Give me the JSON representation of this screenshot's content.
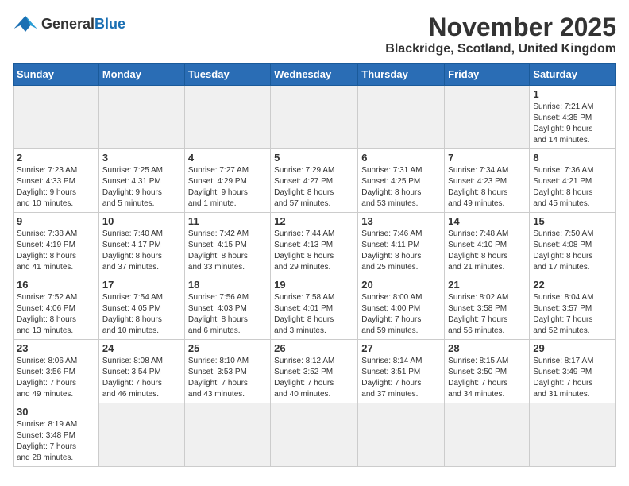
{
  "header": {
    "logo_text_general": "General",
    "logo_text_blue": "Blue",
    "title": "November 2025",
    "subtitle": "Blackridge, Scotland, United Kingdom"
  },
  "days_of_week": [
    "Sunday",
    "Monday",
    "Tuesday",
    "Wednesday",
    "Thursday",
    "Friday",
    "Saturday"
  ],
  "weeks": [
    [
      {
        "day": "",
        "info": ""
      },
      {
        "day": "",
        "info": ""
      },
      {
        "day": "",
        "info": ""
      },
      {
        "day": "",
        "info": ""
      },
      {
        "day": "",
        "info": ""
      },
      {
        "day": "",
        "info": ""
      },
      {
        "day": "1",
        "info": "Sunrise: 7:21 AM\nSunset: 4:35 PM\nDaylight: 9 hours\nand 14 minutes."
      }
    ],
    [
      {
        "day": "2",
        "info": "Sunrise: 7:23 AM\nSunset: 4:33 PM\nDaylight: 9 hours\nand 10 minutes."
      },
      {
        "day": "3",
        "info": "Sunrise: 7:25 AM\nSunset: 4:31 PM\nDaylight: 9 hours\nand 5 minutes."
      },
      {
        "day": "4",
        "info": "Sunrise: 7:27 AM\nSunset: 4:29 PM\nDaylight: 9 hours\nand 1 minute."
      },
      {
        "day": "5",
        "info": "Sunrise: 7:29 AM\nSunset: 4:27 PM\nDaylight: 8 hours\nand 57 minutes."
      },
      {
        "day": "6",
        "info": "Sunrise: 7:31 AM\nSunset: 4:25 PM\nDaylight: 8 hours\nand 53 minutes."
      },
      {
        "day": "7",
        "info": "Sunrise: 7:34 AM\nSunset: 4:23 PM\nDaylight: 8 hours\nand 49 minutes."
      },
      {
        "day": "8",
        "info": "Sunrise: 7:36 AM\nSunset: 4:21 PM\nDaylight: 8 hours\nand 45 minutes."
      }
    ],
    [
      {
        "day": "9",
        "info": "Sunrise: 7:38 AM\nSunset: 4:19 PM\nDaylight: 8 hours\nand 41 minutes."
      },
      {
        "day": "10",
        "info": "Sunrise: 7:40 AM\nSunset: 4:17 PM\nDaylight: 8 hours\nand 37 minutes."
      },
      {
        "day": "11",
        "info": "Sunrise: 7:42 AM\nSunset: 4:15 PM\nDaylight: 8 hours\nand 33 minutes."
      },
      {
        "day": "12",
        "info": "Sunrise: 7:44 AM\nSunset: 4:13 PM\nDaylight: 8 hours\nand 29 minutes."
      },
      {
        "day": "13",
        "info": "Sunrise: 7:46 AM\nSunset: 4:11 PM\nDaylight: 8 hours\nand 25 minutes."
      },
      {
        "day": "14",
        "info": "Sunrise: 7:48 AM\nSunset: 4:10 PM\nDaylight: 8 hours\nand 21 minutes."
      },
      {
        "day": "15",
        "info": "Sunrise: 7:50 AM\nSunset: 4:08 PM\nDaylight: 8 hours\nand 17 minutes."
      }
    ],
    [
      {
        "day": "16",
        "info": "Sunrise: 7:52 AM\nSunset: 4:06 PM\nDaylight: 8 hours\nand 13 minutes."
      },
      {
        "day": "17",
        "info": "Sunrise: 7:54 AM\nSunset: 4:05 PM\nDaylight: 8 hours\nand 10 minutes."
      },
      {
        "day": "18",
        "info": "Sunrise: 7:56 AM\nSunset: 4:03 PM\nDaylight: 8 hours\nand 6 minutes."
      },
      {
        "day": "19",
        "info": "Sunrise: 7:58 AM\nSunset: 4:01 PM\nDaylight: 8 hours\nand 3 minutes."
      },
      {
        "day": "20",
        "info": "Sunrise: 8:00 AM\nSunset: 4:00 PM\nDaylight: 7 hours\nand 59 minutes."
      },
      {
        "day": "21",
        "info": "Sunrise: 8:02 AM\nSunset: 3:58 PM\nDaylight: 7 hours\nand 56 minutes."
      },
      {
        "day": "22",
        "info": "Sunrise: 8:04 AM\nSunset: 3:57 PM\nDaylight: 7 hours\nand 52 minutes."
      }
    ],
    [
      {
        "day": "23",
        "info": "Sunrise: 8:06 AM\nSunset: 3:56 PM\nDaylight: 7 hours\nand 49 minutes."
      },
      {
        "day": "24",
        "info": "Sunrise: 8:08 AM\nSunset: 3:54 PM\nDaylight: 7 hours\nand 46 minutes."
      },
      {
        "day": "25",
        "info": "Sunrise: 8:10 AM\nSunset: 3:53 PM\nDaylight: 7 hours\nand 43 minutes."
      },
      {
        "day": "26",
        "info": "Sunrise: 8:12 AM\nSunset: 3:52 PM\nDaylight: 7 hours\nand 40 minutes."
      },
      {
        "day": "27",
        "info": "Sunrise: 8:14 AM\nSunset: 3:51 PM\nDaylight: 7 hours\nand 37 minutes."
      },
      {
        "day": "28",
        "info": "Sunrise: 8:15 AM\nSunset: 3:50 PM\nDaylight: 7 hours\nand 34 minutes."
      },
      {
        "day": "29",
        "info": "Sunrise: 8:17 AM\nSunset: 3:49 PM\nDaylight: 7 hours\nand 31 minutes."
      }
    ],
    [
      {
        "day": "30",
        "info": "Sunrise: 8:19 AM\nSunset: 3:48 PM\nDaylight: 7 hours\nand 28 minutes."
      },
      {
        "day": "",
        "info": ""
      },
      {
        "day": "",
        "info": ""
      },
      {
        "day": "",
        "info": ""
      },
      {
        "day": "",
        "info": ""
      },
      {
        "day": "",
        "info": ""
      },
      {
        "day": "",
        "info": ""
      }
    ]
  ]
}
